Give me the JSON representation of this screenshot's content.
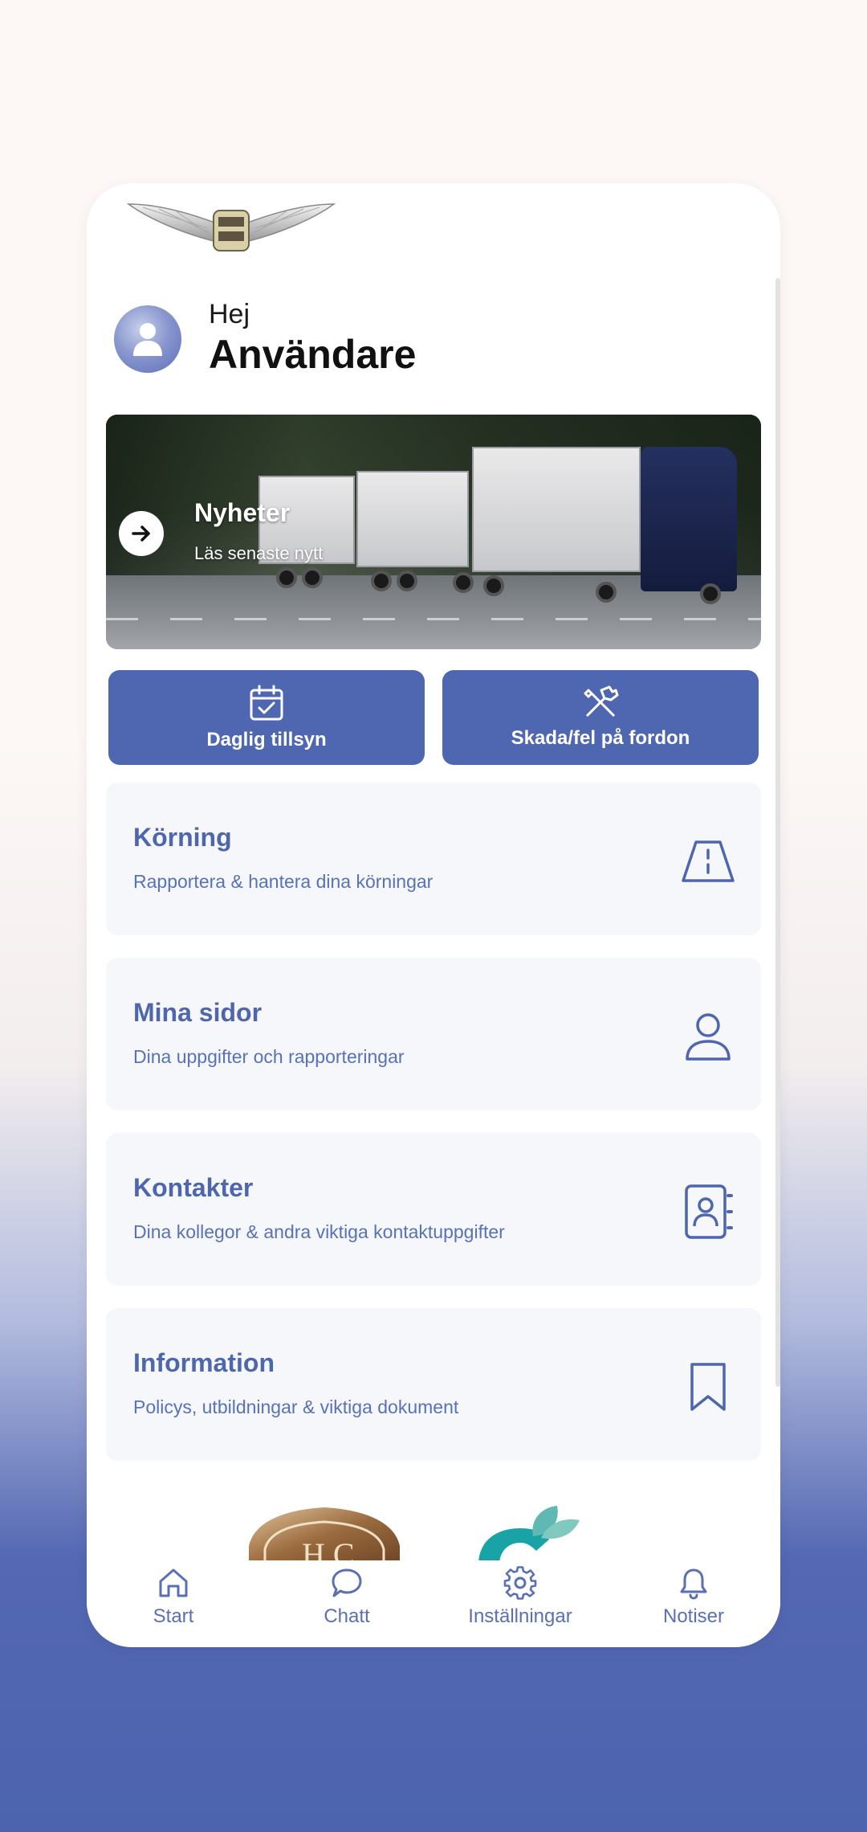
{
  "greeting": {
    "hello": "Hej",
    "name": "Användare"
  },
  "hero": {
    "title": "Nyheter",
    "subtitle": "Läs senaste nytt"
  },
  "actions": [
    {
      "label": "Daglig tillsyn",
      "icon": "calendar-check-icon"
    },
    {
      "label": "Skada/fel på fordon",
      "icon": "tools-icon"
    }
  ],
  "cards": [
    {
      "title": "Körning",
      "subtitle": "Rapportera & hantera dina körningar",
      "icon": "road-icon"
    },
    {
      "title": "Mina sidor",
      "subtitle": "Dina uppgifter och rapporteringar",
      "icon": "user-icon"
    },
    {
      "title": "Kontakter",
      "subtitle": "Dina kollegor & andra viktiga kontaktuppgifter",
      "icon": "contact-book-icon"
    },
    {
      "title": "Information",
      "subtitle": "Policys, utbildningar & viktiga dokument",
      "icon": "bookmark-icon"
    }
  ],
  "tabs": [
    {
      "label": "Start",
      "icon": "home-icon"
    },
    {
      "label": "Chatt",
      "icon": "chat-icon"
    },
    {
      "label": "Inställningar",
      "icon": "gear-icon"
    },
    {
      "label": "Notiser",
      "icon": "bell-icon"
    }
  ],
  "colors": {
    "primary": "#4f67b0",
    "card_bg": "#f6f7fb",
    "text_accent": "#4e66ae"
  }
}
